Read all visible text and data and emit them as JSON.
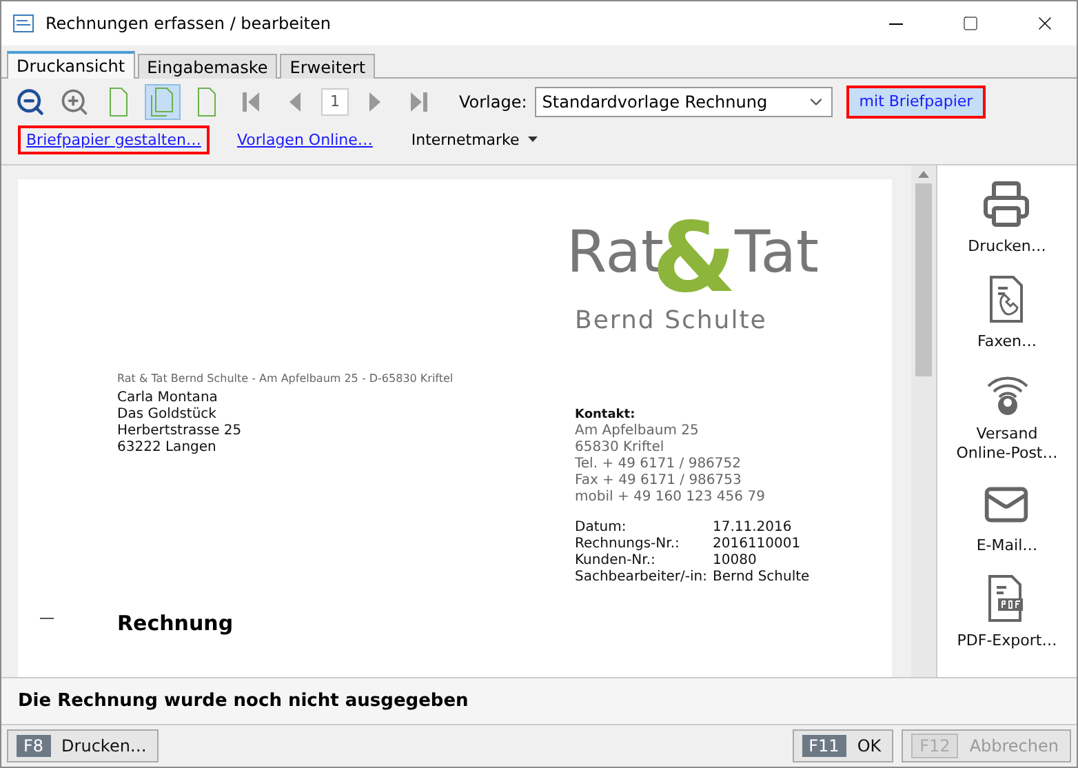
{
  "window": {
    "title": "Rechnungen erfassen / bearbeiten"
  },
  "tabs": [
    {
      "label": "Druckansicht",
      "selected": true
    },
    {
      "label": "Eingabemaske",
      "selected": false
    },
    {
      "label": "Erweitert",
      "selected": false
    }
  ],
  "toolbar": {
    "view_modes": [
      {
        "kind": "single",
        "selected": false
      },
      {
        "kind": "double",
        "selected": true
      },
      {
        "kind": "blank",
        "selected": false
      }
    ],
    "page_number": "1",
    "template_label": "Vorlage:",
    "template_value": "Standardvorlage Rechnung",
    "letterhead_button": {
      "label": "mit Briefpapier",
      "highlighted": true
    }
  },
  "links": [
    {
      "label": "Briefpapier gestalten…",
      "kind": "link",
      "highlighted": true
    },
    {
      "label": "Vorlagen Online…",
      "kind": "link",
      "highlighted": false
    },
    {
      "label": "Internetmarke",
      "kind": "menu",
      "highlighted": false
    }
  ],
  "document": {
    "logo": {
      "left": "Rat",
      "amp": "&",
      "right": "Tat",
      "subtitle": "Bernd Schulte"
    },
    "sender_line": "Rat & Tat Bernd Schulte - Am Apfelbaum 25 - D-65830 Kriftel",
    "recipient": [
      "Carla Montana",
      "Das Goldstück",
      "Herbertstrasse 25",
      "63222 Langen"
    ],
    "contact_heading": "Kontakt:",
    "contact": [
      "Am Apfelbaum 25",
      "65830 Kriftel",
      "Tel. + 49 6171 / 986752",
      "Fax + 49 6171 / 986753",
      "mobil + 49 160 123 456 79"
    ],
    "details": [
      {
        "label": "Datum:",
        "value": "17.11.2016"
      },
      {
        "label": "Rechnungs-Nr.:",
        "value": "2016110001"
      },
      {
        "label": "Kunden-Nr.:",
        "value": "10080"
      },
      {
        "label": "Sachbearbeiter/-in:",
        "value": "Bernd Schulte"
      }
    ],
    "heading": "Rechnung"
  },
  "actions": [
    {
      "kind": "print",
      "lines": [
        "Drucken…"
      ]
    },
    {
      "kind": "fax",
      "lines": [
        "Faxen…"
      ]
    },
    {
      "kind": "post",
      "lines": [
        "Versand",
        "Online-Post…"
      ]
    },
    {
      "kind": "mail",
      "lines": [
        "E-Mail…"
      ]
    },
    {
      "kind": "pdf",
      "lines": [
        "PDF-Export…"
      ]
    }
  ],
  "status": "Die Rechnung wurde noch nicht ausgegeben",
  "buttons": [
    {
      "key": "F8",
      "label": "Drucken…",
      "disabled": false
    },
    {
      "key": "F11",
      "label": "OK",
      "disabled": false
    },
    {
      "key": "F12",
      "label": "Abbrechen",
      "disabled": true
    }
  ]
}
